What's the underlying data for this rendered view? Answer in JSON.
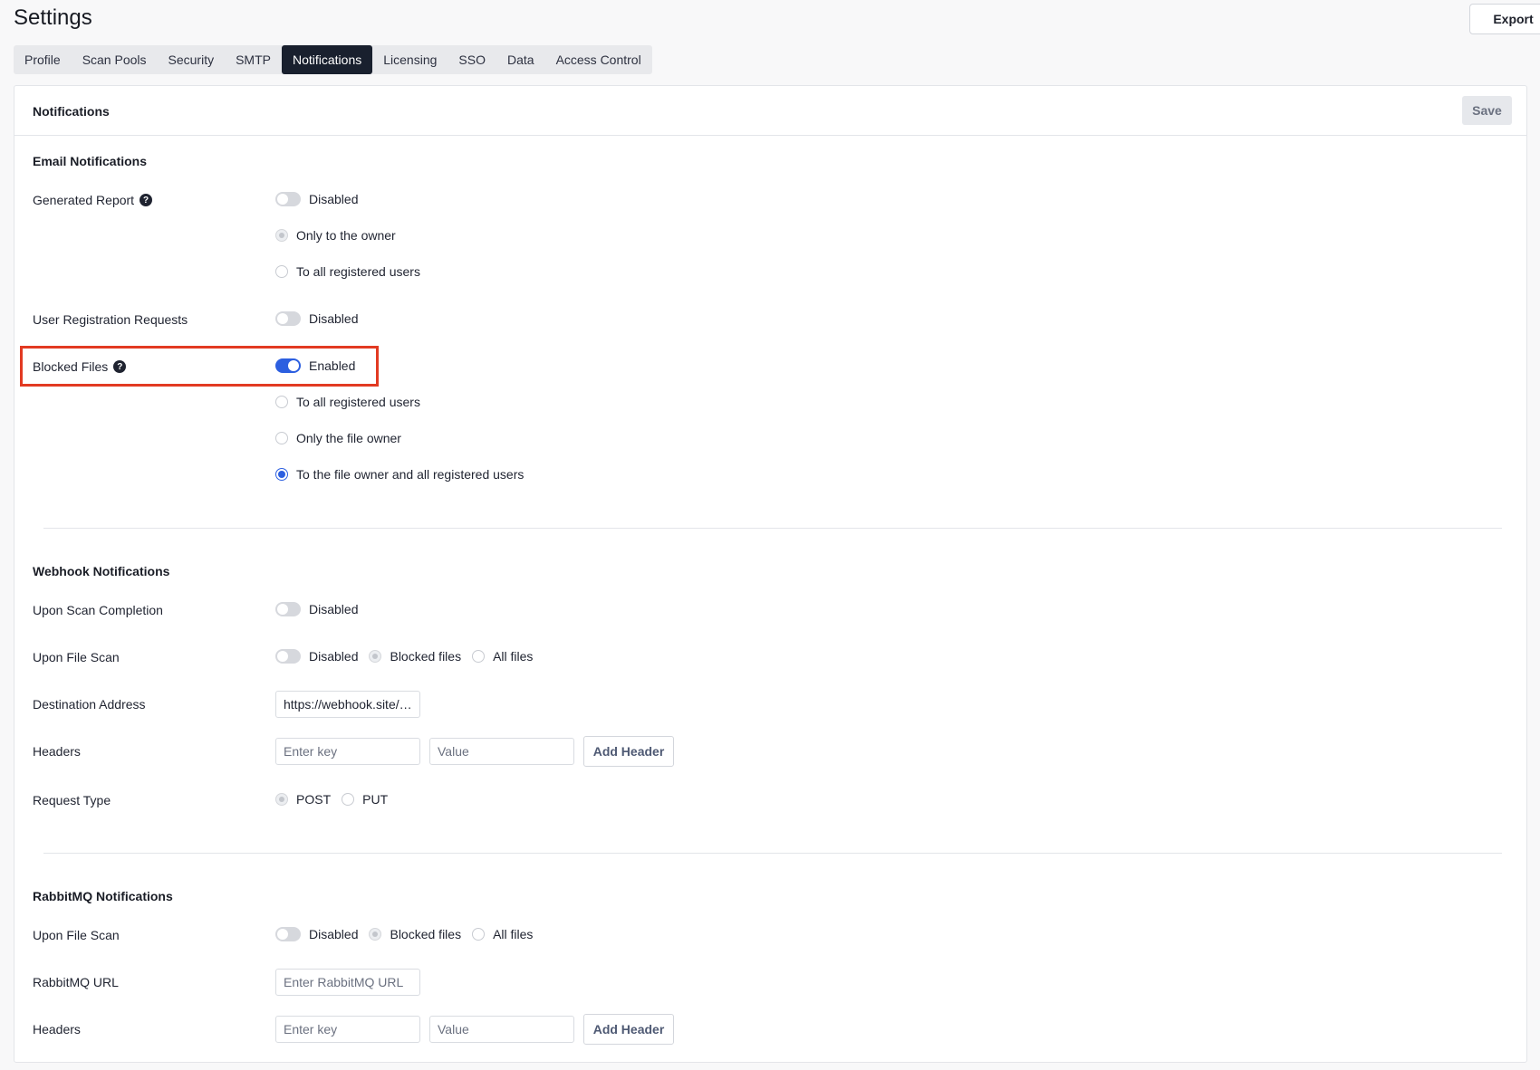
{
  "page": {
    "title": "Settings",
    "export_label": "Export"
  },
  "tabs": [
    {
      "label": "Profile"
    },
    {
      "label": "Scan Pools"
    },
    {
      "label": "Security"
    },
    {
      "label": "SMTP"
    },
    {
      "label": "Notifications",
      "active": true
    },
    {
      "label": "Licensing"
    },
    {
      "label": "SSO"
    },
    {
      "label": "Data"
    },
    {
      "label": "Access Control"
    }
  ],
  "card": {
    "title": "Notifications",
    "save_label": "Save"
  },
  "email": {
    "title": "Email Notifications",
    "generated_report": {
      "label": "Generated Report",
      "toggle_state": "Disabled",
      "options": [
        "Only to the owner",
        "To all registered users"
      ]
    },
    "user_registration": {
      "label": "User Registration Requests",
      "toggle_state": "Disabled"
    },
    "blocked_files": {
      "label": "Blocked Files",
      "toggle_state": "Enabled",
      "options": [
        "To all registered users",
        "Only the file owner",
        "To the file owner and all registered users"
      ],
      "selected": "To the file owner and all registered users"
    }
  },
  "webhook": {
    "title": "Webhook Notifications",
    "scan_completion": {
      "label": "Upon Scan Completion",
      "toggle_state": "Disabled"
    },
    "file_scan": {
      "label": "Upon File Scan",
      "toggle_state": "Disabled",
      "options": [
        "Blocked files",
        "All files"
      ]
    },
    "destination": {
      "label": "Destination Address",
      "value": "https://webhook.site/…"
    },
    "headers": {
      "label": "Headers",
      "key_placeholder": "Enter key",
      "value_placeholder": "Value",
      "add_label": "Add Header"
    },
    "request_type": {
      "label": "Request Type",
      "options": [
        "POST",
        "PUT"
      ]
    }
  },
  "rabbitmq": {
    "title": "RabbitMQ Notifications",
    "file_scan": {
      "label": "Upon File Scan",
      "toggle_state": "Disabled",
      "options": [
        "Blocked files",
        "All files"
      ]
    },
    "url": {
      "label": "RabbitMQ URL",
      "placeholder": "Enter RabbitMQ URL"
    },
    "headers": {
      "label": "Headers",
      "key_placeholder": "Enter key",
      "value_placeholder": "Value",
      "add_label": "Add Header"
    }
  },
  "colors": {
    "accent": "#2c5fe0",
    "active_tab": "#19202e",
    "highlight": "#e23a22"
  }
}
